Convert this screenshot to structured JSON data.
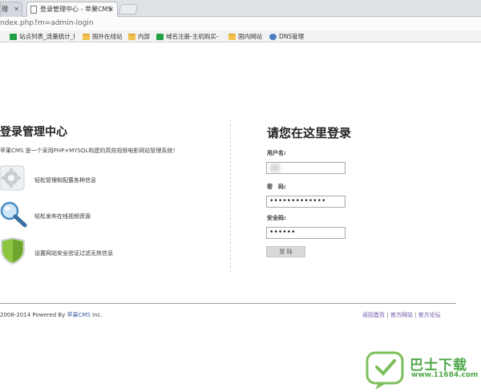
{
  "browser": {
    "tabs": [
      {
        "label": "理",
        "active": false
      },
      {
        "label": "登录管理中心 - 苹果CMS",
        "active": true
      }
    ],
    "url": "ndex.php?m=admin-login",
    "bookmarks": [
      {
        "label": "站点列表_流量统计_I",
        "icon": "green-app-icon"
      },
      {
        "label": "国外在线站",
        "icon": "folder-icon"
      },
      {
        "label": "内部",
        "icon": "folder-icon"
      },
      {
        "label": "域名注册-主机购买-",
        "icon": "green-app-icon"
      },
      {
        "label": "国内网站",
        "icon": "folder-icon"
      },
      {
        "label": "DNS管理",
        "icon": "globe-icon"
      }
    ]
  },
  "left": {
    "title": "登录管理中心",
    "desc": "苹果CMS 是一个采用PHP+MYSQL构建的高效视频电影网站管理系统！",
    "features": [
      {
        "icon": "gear-icon",
        "text": "轻松管理和配置各种信息"
      },
      {
        "icon": "magnifier-icon",
        "text": "轻松发布在线视频资源"
      },
      {
        "icon": "shield-icon",
        "text": "设置网站安全验证过滤无效信息"
      }
    ]
  },
  "login": {
    "title": "请您在这里登录",
    "username_label": "用户名:",
    "username_value": "",
    "password_label": "密　码:",
    "password_value": "•••••••••••••",
    "code_label": "安全码:",
    "code_value": "••••••",
    "button_label": "登 陆"
  },
  "footer": {
    "copyright_prefix": "2008-2014 Powered By",
    "brand": "苹果CMS",
    "copyright_suffix": "Inc.",
    "links": [
      "返回首页",
      "官方网站",
      "官方论坛"
    ],
    "separator": "|"
  },
  "watermark": {
    "text": "巴士下载",
    "url": "www.11684.com"
  }
}
